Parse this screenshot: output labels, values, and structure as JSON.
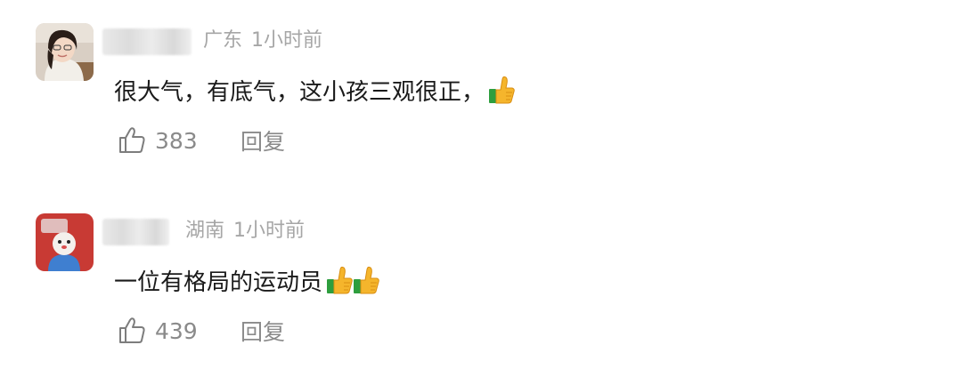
{
  "comments": [
    {
      "region": "广东",
      "time": "1小时前",
      "text": "很大气，有底气，这小孩三观很正，",
      "emoji_count": 1,
      "likes": "383",
      "reply_label": "回复"
    },
    {
      "region": "湖南",
      "time": "1小时前",
      "text": "一位有格局的运动员",
      "emoji_count": 2,
      "likes": "439",
      "reply_label": "回复"
    }
  ],
  "icons": {
    "like": "thumbs-up-outline-icon",
    "emoji": "thumbs-up-emoji-icon"
  },
  "colors": {
    "meta_text": "#a6a6a6",
    "body_text": "#1a1a1a",
    "action_text": "#8a8a8a",
    "emoji_hand": "#f5b52c",
    "emoji_cuff": "#2e9e3e"
  }
}
